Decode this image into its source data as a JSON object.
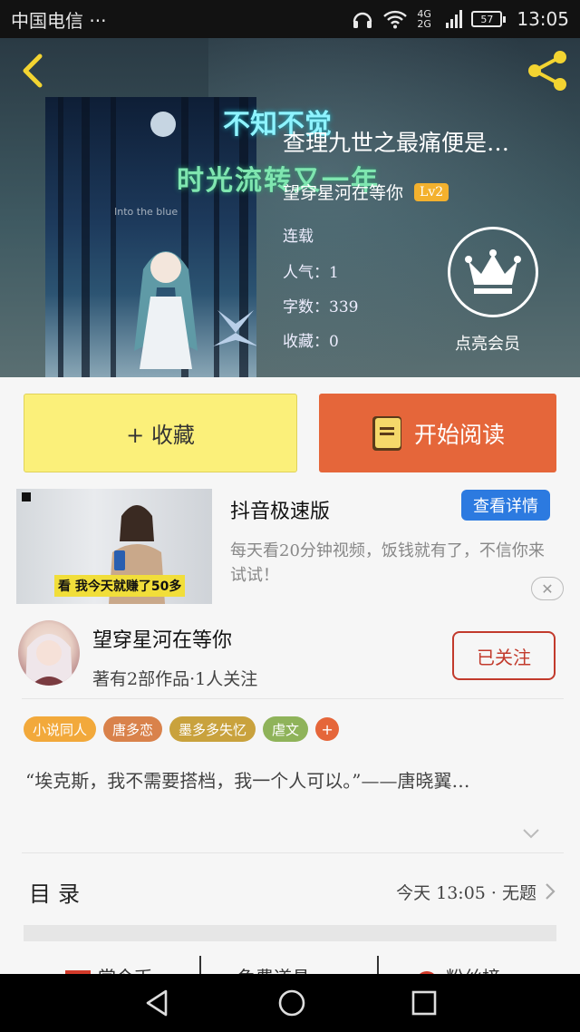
{
  "status_bar": {
    "carrier": "中国电信",
    "dots": "···",
    "network": "4G 2G",
    "battery": "57",
    "time": "13:05"
  },
  "hero": {
    "cover_text_line1": "不知不觉",
    "cover_text_line2": "时光流转又一年",
    "cover_small_text": "Into the blue",
    "book_title": "查理九世之最痛便是…",
    "author": "望穿星河在等你",
    "level": "Lv2",
    "status": "连载",
    "popularity": "人气：1",
    "word_count": "字数：339",
    "favorites": "收藏：0",
    "vip_label": "点亮会员"
  },
  "actions": {
    "collect": "+ 收藏",
    "read": "开始阅读"
  },
  "ad": {
    "title": "抖音极速版",
    "button": "查看详情",
    "description": "每天看20分钟视频，饭钱就有了，不信你来试试！",
    "thumb_caption": "看 我今天就赚了50多",
    "close": "✕"
  },
  "author_card": {
    "name": "望穿星河在等你",
    "stats": "著有2部作品·1人关注",
    "follow": "已关注"
  },
  "tags": [
    {
      "label": "小说同人",
      "color": "#f2a93b"
    },
    {
      "label": "唐多恋",
      "color": "#d9824b"
    },
    {
      "label": "墨多多失忆",
      "color": "#c9a23d"
    },
    {
      "label": "虐文",
      "color": "#8fb35a"
    }
  ],
  "tag_more": "+",
  "intro": "“埃克斯，我不需要搭档，我一个人可以。”——唐晓翼…",
  "toc": {
    "label": "目录",
    "latest": "今天 13:05 · 无题"
  },
  "bottom_items": [
    "赏今币",
    "免费道具",
    "粉丝榜"
  ]
}
